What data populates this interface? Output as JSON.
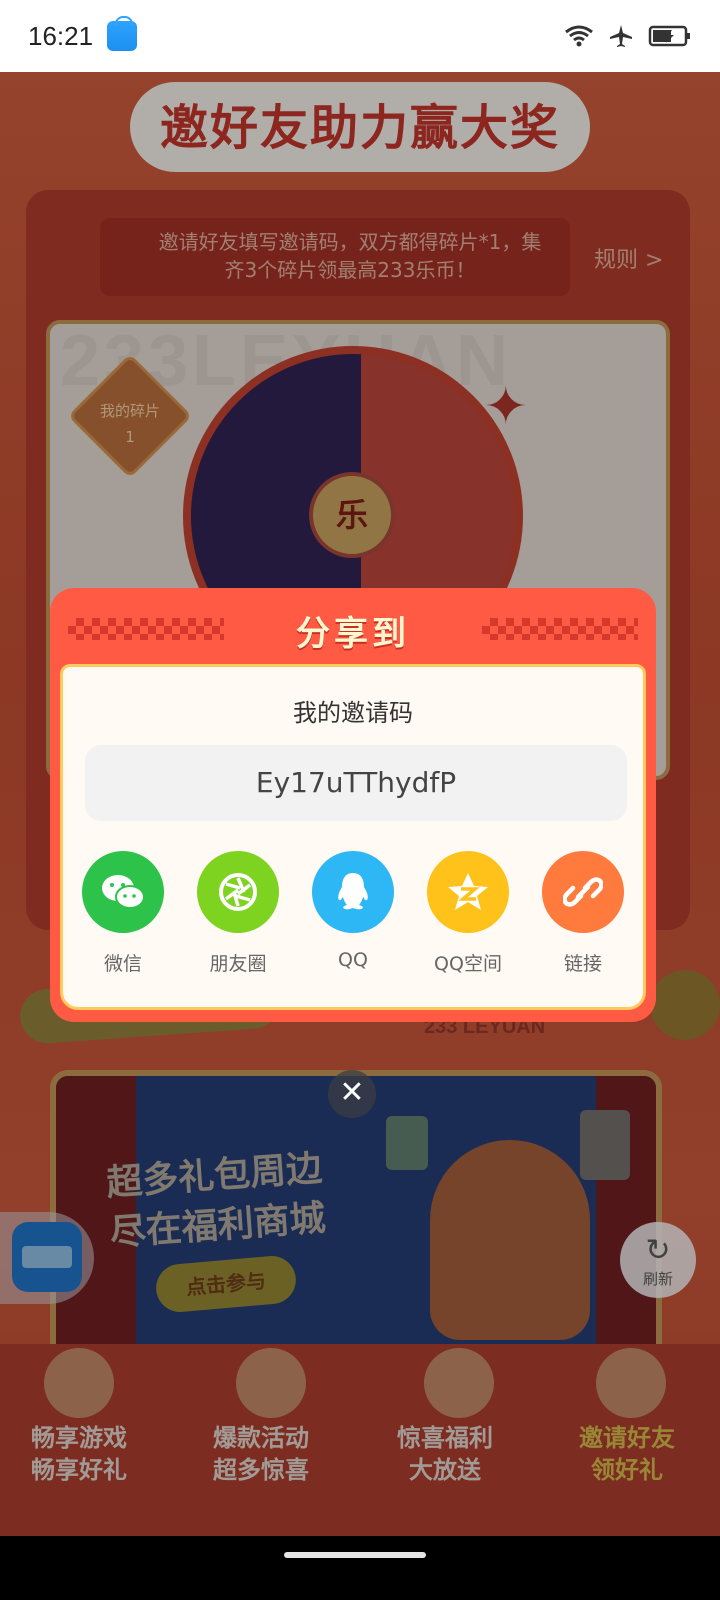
{
  "status_bar": {
    "time": "16:21",
    "app_icon": "shopping-bag-icon",
    "icons": [
      "wifi-icon",
      "airplane-mode-icon",
      "battery-charging-icon"
    ]
  },
  "background_page": {
    "title": "邀好友助力赢大奖",
    "banner_text": "邀请好友填写邀请码，双方都得碎片*1，集齐3个碎片领最高233乐币！",
    "rules_link": "规则 >",
    "brand_watermark": "233LEYUAN",
    "fragments_label": "我的碎片",
    "fragments_count": "1",
    "wheel_center": "乐",
    "brand_small": "233 LEYUAN",
    "mall_headline": "超多礼包周边 尽在福利商城",
    "mall_button": "点击参与",
    "refresh_label": "刷新",
    "tabs": [
      {
        "line1": "畅享游戏",
        "line2": "畅享好礼"
      },
      {
        "line1": "爆款活动",
        "line2": "超多惊喜"
      },
      {
        "line1": "惊喜福利",
        "line2": "大放送"
      },
      {
        "line1": "邀请好友",
        "line2": "领好礼"
      }
    ]
  },
  "share_dialog": {
    "title": "分享到",
    "code_label": "我的邀请码",
    "invite_code": "Ey17uTThydfP",
    "share_targets": [
      {
        "label": "微信",
        "icon": "wechat-icon",
        "color": "#2dc24a"
      },
      {
        "label": "朋友圈",
        "icon": "moments-icon",
        "color": "#7ed321"
      },
      {
        "label": "QQ",
        "icon": "qq-icon",
        "color": "#2eb7f5"
      },
      {
        "label": "QQ空间",
        "icon": "qzone-icon",
        "color": "#ffc21a"
      },
      {
        "label": "链接",
        "icon": "link-icon",
        "color": "#ff7a3d"
      }
    ],
    "close_icon": "close-icon"
  },
  "colors": {
    "dialog_red": "#ff5a43",
    "dialog_title": "#fff6d2",
    "inner_bg": "#fffaf3",
    "inner_border": "#ffca5a"
  }
}
